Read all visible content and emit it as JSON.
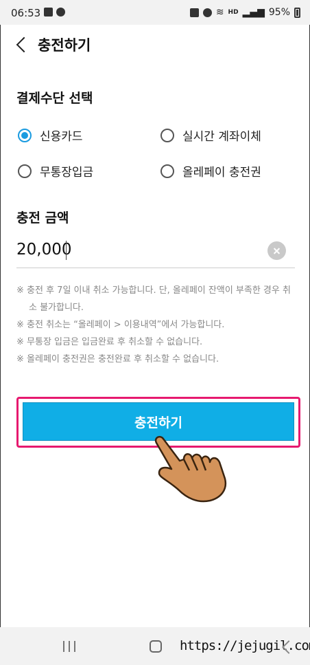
{
  "status_bar": {
    "time": "06:53",
    "battery": "95%",
    "network_badge": "HD"
  },
  "header": {
    "title": "충전하기"
  },
  "payment": {
    "section_title": "결제수단 선택",
    "options": [
      {
        "label": "신용카드",
        "selected": true
      },
      {
        "label": "실시간 계좌이체",
        "selected": false
      },
      {
        "label": "무통장입금",
        "selected": false
      },
      {
        "label": "올레페이 충전권",
        "selected": false
      }
    ]
  },
  "amount": {
    "section_title": "충전 금액",
    "value": "20,000"
  },
  "notes": [
    "※ 충전 후 7일 이내 취소 가능합니다. 단, 올레페이 잔액이 부족한 경우 취소 불가합니다.",
    "※ 충전 취소는 “올레페이 > 이용내역”에서 가능합니다.",
    "※ 무통장 입금은 입금완료 후 취소할 수 없습니다.",
    "※ 올레페이 충전권은 충전완료 후 취소할 수 없습니다."
  ],
  "submit": {
    "label": "충전하기"
  },
  "overlay": {
    "watermark": "https://jejugil.com",
    "highlight_color": "#e6196f",
    "pointer": "hand-pointer-icon"
  },
  "colors": {
    "accent": "#10aee6",
    "radio_selected": "#1a9be0"
  }
}
